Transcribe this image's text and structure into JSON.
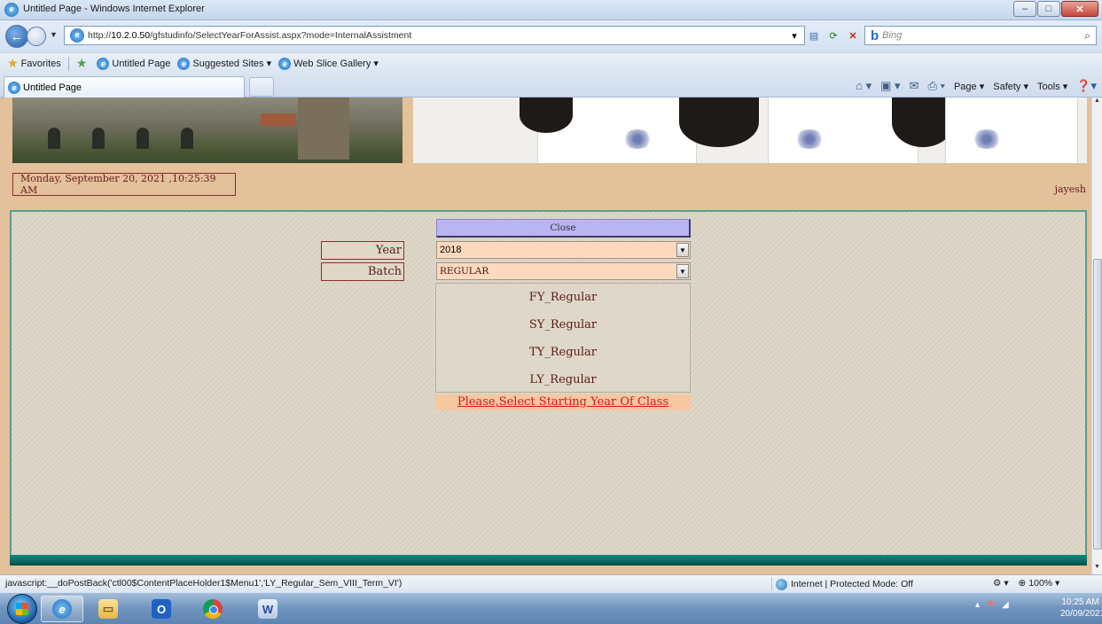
{
  "window": {
    "title": "Untitled Page - Windows Internet Explorer",
    "minimize_glyph": "–",
    "maximize_glyph": "□",
    "close_glyph": "✕"
  },
  "address_bar": {
    "url_prefix": "http://",
    "url_host": "10.2.0.50",
    "url_path": "/gfstudinfo/SelectYearForAssist.aspx?mode=InternalAssistment",
    "search_placeholder": "Bing"
  },
  "favorites_bar": {
    "favorites_label": "Favorites",
    "items": [
      "Untitled Page",
      "Suggested Sites ▾",
      "Web Slice Gallery ▾"
    ]
  },
  "tabs": [
    {
      "label": "Untitled Page"
    }
  ],
  "command_bar": {
    "page_label": "Page ▾",
    "safety_label": "Safety ▾",
    "tools_label": "Tools ▾"
  },
  "page": {
    "datetime": "Monday, September 20, 2021 ,10:25:39 AM",
    "username": "jayesh",
    "close_button": "Close",
    "year_label": "Year",
    "year_value": "2018",
    "batch_label": "Batch",
    "batch_value": "REGULAR",
    "menu_items": [
      "FY_Regular",
      "SY_Regular",
      "TY_Regular",
      "LY_Regular"
    ],
    "hint_link": "Please,Select Starting Year Of Class"
  },
  "status_bar": {
    "text": "javascript:__doPostBack('ctl00$ContentPlaceHolder1$Menu1','LY_Regular_Sem_VIII_Term_VI')",
    "zone": "Internet | Protected Mode: Off",
    "zoom": "100%"
  },
  "taskbar": {
    "apps": [
      "internet-explorer",
      "file-explorer",
      "outlook",
      "chrome",
      "word"
    ],
    "time": "10:25 AM",
    "date": "20/09/2021"
  },
  "colors": {
    "banner_bg": "#e2c19b",
    "close_button_bg": "#b9b5f2",
    "select_bg": "#fbd9bf",
    "hint_text": "#d21a1a",
    "teal_bar": "#0f8a80"
  }
}
